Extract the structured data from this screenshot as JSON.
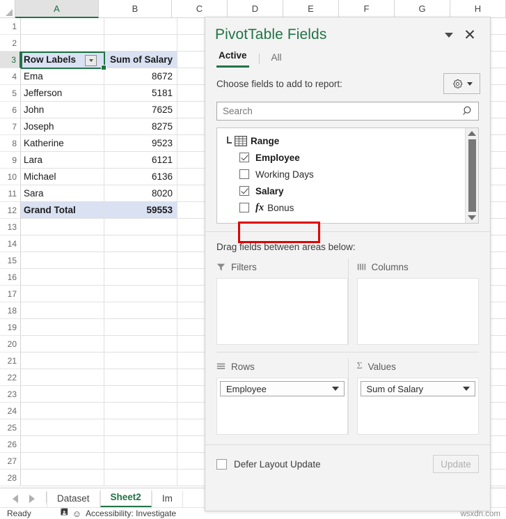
{
  "grid": {
    "column_headers": [
      "A",
      "B",
      "C",
      "D",
      "E",
      "F",
      "G",
      "H"
    ],
    "selected_column": "A",
    "selected_row": 3,
    "selected_cell": "A3",
    "row_numbers": [
      1,
      2,
      3,
      4,
      5,
      6,
      7,
      8,
      9,
      10,
      11,
      12,
      13,
      14,
      15,
      16,
      17,
      18,
      19,
      20,
      21,
      22,
      23,
      24,
      25,
      26,
      27,
      28
    ],
    "pivot_table": {
      "header": {
        "row_labels": "Row Labels",
        "value_header": "Sum of Salary"
      },
      "rows": [
        {
          "label": "Ema",
          "value": "8672"
        },
        {
          "label": "Jefferson",
          "value": "5181"
        },
        {
          "label": "John",
          "value": "7625"
        },
        {
          "label": "Joseph",
          "value": "8275"
        },
        {
          "label": "Katherine",
          "value": "9523"
        },
        {
          "label": "Lara",
          "value": "6121"
        },
        {
          "label": "Michael",
          "value": "6136"
        },
        {
          "label": "Sara",
          "value": "8020"
        }
      ],
      "total": {
        "label": "Grand Total",
        "value": "59553"
      }
    }
  },
  "sheet_tabs": {
    "tabs": [
      {
        "name": "Dataset",
        "active": false
      },
      {
        "name": "Sheet2",
        "active": true
      },
      {
        "name": "Im",
        "active": false
      }
    ]
  },
  "status_bar": {
    "ready": "Ready",
    "accessibility": "Accessibility: Investigate"
  },
  "panel": {
    "title": "PivotTable Fields",
    "collapse_icon": "chevron-down-icon",
    "close_icon": "close-icon",
    "tabs": [
      {
        "label": "Active",
        "active": true
      },
      {
        "label": "All",
        "active": false
      }
    ],
    "choose_label": "Choose fields to add to report:",
    "tools_icon": "gear-icon",
    "search": {
      "placeholder": "Search",
      "value": "",
      "icon": "search-icon"
    },
    "field_list": {
      "group": {
        "label": "Range",
        "icon": "table-icon",
        "expanded": true
      },
      "fields": [
        {
          "label": "Employee",
          "checked": true,
          "bold": true,
          "formula": false,
          "highlighted": false
        },
        {
          "label": "Working Days",
          "checked": false,
          "bold": false,
          "formula": false,
          "highlighted": false
        },
        {
          "label": "Salary",
          "checked": true,
          "bold": true,
          "formula": false,
          "highlighted": false
        },
        {
          "label": "Bonus",
          "checked": false,
          "bold": false,
          "formula": true,
          "highlighted": true
        }
      ]
    },
    "drag_note": "Drag fields between areas below:",
    "areas": [
      {
        "label": "Filters",
        "icon": "filter-icon",
        "items": []
      },
      {
        "label": "Columns",
        "icon": "columns-icon",
        "items": []
      },
      {
        "label": "Rows",
        "icon": "rows-icon",
        "items": [
          "Employee"
        ]
      },
      {
        "label": "Values",
        "icon": "sigma-icon",
        "items": [
          "Sum of Salary"
        ]
      }
    ],
    "defer_label": "Defer Layout Update",
    "defer_checked": false,
    "update_label": "Update",
    "update_enabled": false
  },
  "watermark": "wsxdn.com",
  "colors": {
    "excel_green": "#217346",
    "pivot_header_fill": "#d9e1f2",
    "highlight_red": "#e00000"
  }
}
